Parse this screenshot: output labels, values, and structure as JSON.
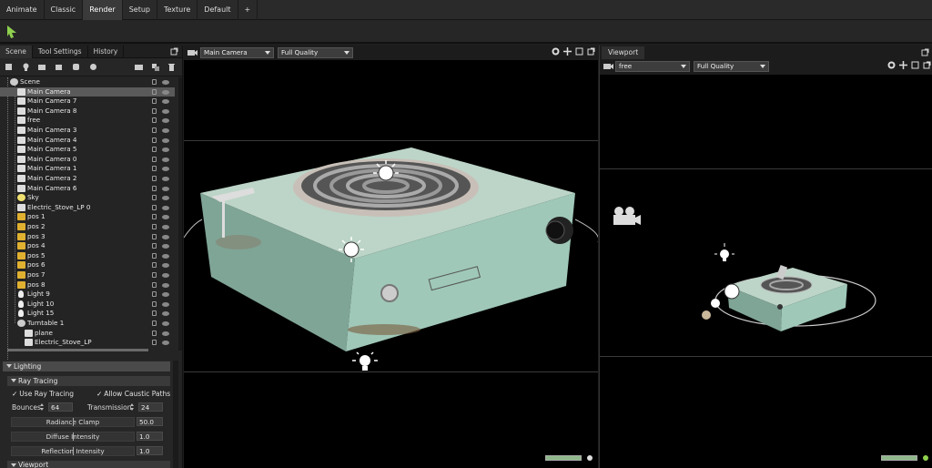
{
  "menu_tabs": [
    "Animate",
    "Classic",
    "Render",
    "Setup",
    "Texture",
    "Default",
    "+"
  ],
  "active_menu_tab": "Render",
  "panel_tabs": [
    "Scene",
    "Tool Settings",
    "History"
  ],
  "tree": {
    "root": "Scene",
    "items": [
      "Main Camera",
      "Main Camera 7",
      "Main Camera 8",
      "free",
      "Main Camera 3",
      "Main Camera 4",
      "Main Camera 5",
      "Main Camera 0",
      "Main Camera 1",
      "Main Camera 2",
      "Main Camera 6",
      "Sky",
      "Electric_Stove_LP 0",
      "pos 1",
      "pos 2",
      "pos 3",
      "pos 4",
      "pos 5",
      "pos 6",
      "pos 7",
      "pos 8",
      "Light 9",
      "Light 10",
      "Light 15",
      "Turntable 1"
    ],
    "children": [
      "plane",
      "Electric_Stove_LP"
    ]
  },
  "lighting": {
    "header": "Lighting",
    "subheader": "Ray Tracing",
    "use_ray_tracing": "Use Ray Tracing",
    "allow_caustic": "Allow Caustic Paths",
    "bounces_label": "Bounces",
    "bounces_value": "64",
    "transmission_label": "Transmission",
    "transmission_value": "24",
    "radiance_label": "Radiance Clamp",
    "radiance_value": "50.0",
    "diffuse_label": "Diffuse Intensity",
    "diffuse_value": "1.0",
    "reflection_label": "Reflection Intensity",
    "reflection_value": "1.0",
    "next_section": "Viewport"
  },
  "main_viewport": {
    "camera": "Main Camera",
    "quality": "Full Quality"
  },
  "right_viewport": {
    "tab": "Viewport",
    "camera": "free",
    "quality": "Full Quality"
  },
  "colors": {
    "accent_green": "#8fd14f",
    "status_green": "#8fb88a",
    "stove_body": "#9fc8b8",
    "folder": "#e0b030"
  }
}
